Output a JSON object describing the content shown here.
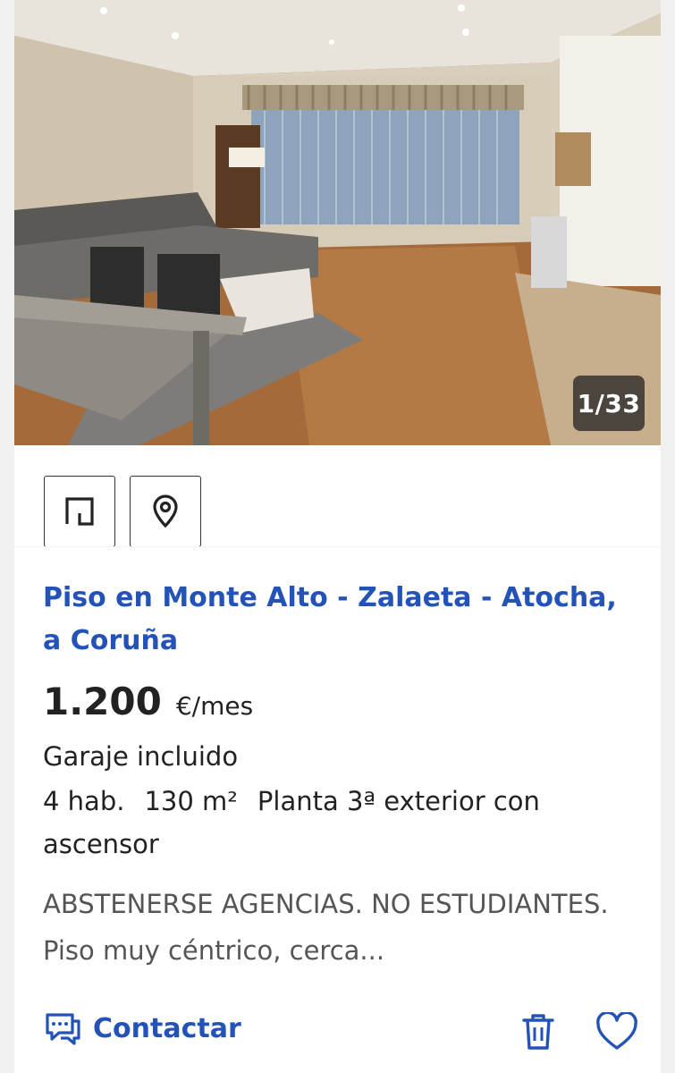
{
  "listing": {
    "photo_counter": "1/33",
    "title": "Piso en Monte Alto - Zalaeta - Atocha, a Coruña",
    "price": "1.200",
    "price_unit": "€/mes",
    "garage": "Garaje incluido",
    "features": [
      "4 hab.",
      "130 m²",
      "Planta 3ª exterior con ascensor"
    ],
    "description": "ABSTENERSE AGENCIAS. NO ESTUDIANTES. Piso muy céntrico, cerca...",
    "contact_label": "Contactar"
  },
  "icons": {
    "plan": "floor-plan-icon",
    "location": "map-pin-icon",
    "contact": "chat-icon",
    "discard": "trash-icon",
    "favorite": "heart-icon"
  },
  "colors": {
    "accent": "#2453b7",
    "text": "#222222",
    "muted": "#555555"
  }
}
